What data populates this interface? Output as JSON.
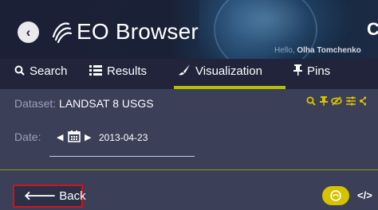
{
  "header": {
    "app_title": "EO Browser",
    "greeting": "Hello,",
    "user_name": "Olha Tomchenko",
    "corner_glyph": "C"
  },
  "tabs": [
    {
      "label": "Search",
      "icon": "search-icon"
    },
    {
      "label": "Results",
      "icon": "list-icon"
    },
    {
      "label": "Visualization",
      "icon": "brush-icon",
      "active": true
    },
    {
      "label": "Pins",
      "icon": "pin-icon"
    }
  ],
  "panel": {
    "dataset_label": "Dataset:",
    "dataset_value": "LANDSAT 8 USGS",
    "date_label": "Date:",
    "date_value": "2013-04-23",
    "back_label": "Back"
  },
  "colors": {
    "accent": "#b6bf00",
    "highlight_border": "#d0141c",
    "toolbar_icons": "#d9c200"
  }
}
